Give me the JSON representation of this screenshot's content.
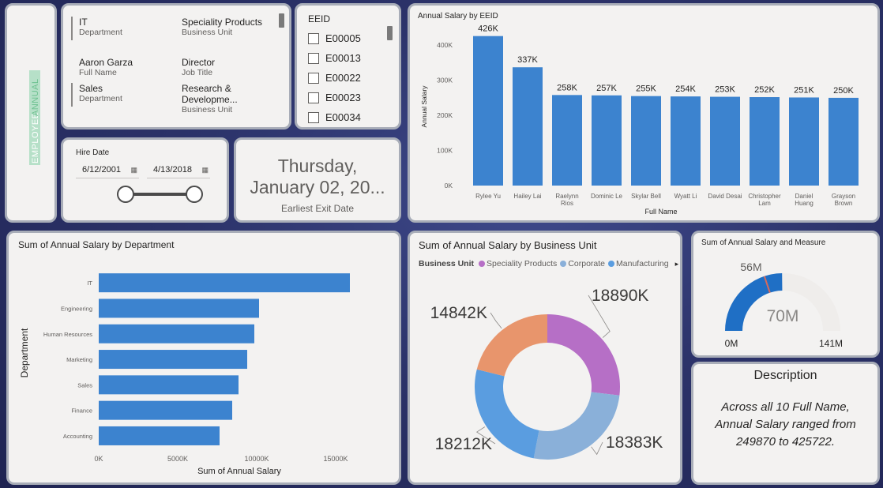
{
  "sidebar": {
    "employee": "EMPLOYEE",
    "annual": "ANNUAL"
  },
  "details": {
    "items": [
      {
        "value": "IT",
        "label": "Department"
      },
      {
        "value": "Speciality Products",
        "label": "Business Unit"
      },
      {
        "value": "Aaron Garza",
        "label": "Full Name"
      },
      {
        "value": "Director",
        "label": "Job Title"
      },
      {
        "value": "Sales",
        "label": "Department"
      },
      {
        "value": "Research & Developme...",
        "label": "Business Unit"
      }
    ]
  },
  "eeid_slicer": {
    "title": "EEID",
    "items": [
      "E00005",
      "E00013",
      "E00022",
      "E00023",
      "E00034"
    ]
  },
  "hire_date": {
    "title": "Hire Date",
    "start": "6/12/2001",
    "end": "4/13/2018"
  },
  "exit_card": {
    "line1": "Thursday,",
    "line2": "January 02, 20...",
    "caption": "Earliest Exit Date"
  },
  "eeid_chart": {
    "title": "Annual Salary by EEID",
    "xlabel": "Full Name",
    "ylabel": "Annual Salary",
    "yticks": [
      "0K",
      "100K",
      "200K",
      "300K",
      "400K"
    ],
    "color": "#3c83cf"
  },
  "dept_chart": {
    "title": "Sum of Annual Salary by Department",
    "xlabel": "Sum of Annual Salary",
    "ylabel": "Department",
    "xticks": [
      "0K",
      "5000K",
      "10000K",
      "15000K"
    ],
    "color": "#3c83cf"
  },
  "bu_chart": {
    "title": "Sum of Annual Salary by Business Unit",
    "legend_title": "Business Unit",
    "legend": [
      {
        "name": "Speciality Products",
        "color": "#b66fc6"
      },
      {
        "name": "Corporate",
        "color": "#8ab0d9"
      },
      {
        "name": "Manufacturing",
        "color": "#5a9de0"
      }
    ],
    "legend_more": "▸"
  },
  "gauge": {
    "title": "Sum of Annual Salary and Measure",
    "value_label": "70M",
    "target_label": "56M",
    "min_label": "0M",
    "max_label": "141M"
  },
  "description": {
    "title": "Description",
    "text": "Across all 10 Full Name, Annual Salary ranged from 249870 to 425722."
  },
  "chart_data": [
    {
      "type": "bar",
      "title": "Annual Salary by EEID",
      "xlabel": "Full Name",
      "ylabel": "Annual Salary",
      "categories": [
        "Rylee Yu",
        "Hailey Lai",
        "Raelynn Rios",
        "Dominic Le",
        "Skylar Bell",
        "Wyatt Li",
        "David Desai",
        "Christopher Lam",
        "Daniel Huang",
        "Grayson Brown"
      ],
      "values": [
        426,
        337,
        258,
        257,
        255,
        254,
        253,
        252,
        251,
        250
      ],
      "data_labels": [
        "426K",
        "337K",
        "258K",
        "257K",
        "255K",
        "254K",
        "253K",
        "252K",
        "251K",
        "250K"
      ],
      "unit": "K",
      "ylim": [
        0,
        450
      ],
      "grid": false
    },
    {
      "type": "bar",
      "orientation": "horizontal",
      "title": "Sum of Annual Salary by Department",
      "xlabel": "Sum of Annual Salary",
      "ylabel": "Department",
      "categories": [
        "IT",
        "Engineering",
        "Human Resources",
        "Marketing",
        "Sales",
        "Finance",
        "Accounting"
      ],
      "values": [
        15900,
        10150,
        9850,
        9400,
        8850,
        8450,
        7650
      ],
      "unit": "K",
      "xlim": [
        0,
        17000
      ]
    },
    {
      "type": "pie",
      "title": "Sum of Annual Salary by Business Unit",
      "donut": true,
      "slices": [
        {
          "label": "18890K",
          "value": 18890,
          "color": "#b66fc6"
        },
        {
          "label": "18383K",
          "value": 18383,
          "color": "#8ab0d9"
        },
        {
          "label": "18212K",
          "value": 18212,
          "color": "#5a9de0"
        },
        {
          "label": "14842K",
          "value": 14842,
          "color": "#e8956c"
        }
      ]
    },
    {
      "type": "gauge",
      "title": "Sum of Annual Salary and Measure",
      "value": 70,
      "target": 56,
      "min": 0,
      "max": 141,
      "unit": "M",
      "color": "#1f6fc5"
    }
  ]
}
